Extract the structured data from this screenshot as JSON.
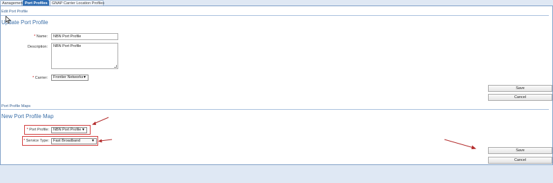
{
  "tabs": [
    {
      "label": "Aanagement",
      "active": false
    },
    {
      "label": "Port Profiles",
      "active": true
    },
    {
      "label": "GNAP Carrier Location Profiles",
      "active": false
    }
  ],
  "edit_section": {
    "header": "Edit Port Profile",
    "title": "Update Port Profile",
    "fields": {
      "name": {
        "label": "Name:",
        "required": true,
        "value": "NBN Port Profile"
      },
      "description": {
        "label": "Description:",
        "value": "NBN Port Profile"
      },
      "carrier": {
        "label": "Carrier:",
        "required": true,
        "value": "Frontier Networks"
      }
    },
    "save_label": "Save",
    "cancel_label": "Cancel"
  },
  "map_section": {
    "header": "Port Profile Maps",
    "title": "New Port Profile Map",
    "fields": {
      "port_profile": {
        "label": "Port Profile:",
        "required": true,
        "value": "NBN Port Profile"
      },
      "service_type": {
        "label": "Service Type:",
        "required": true,
        "value": "Fast Broadband"
      }
    },
    "save_label": "Save",
    "cancel_label": "Cancel"
  },
  "required_marker": "*",
  "dropdown_arrow": "▼",
  "colors": {
    "accent": "#2f6db3",
    "annotation": "#b22a2a",
    "highlight_border": "#d23b3b"
  }
}
